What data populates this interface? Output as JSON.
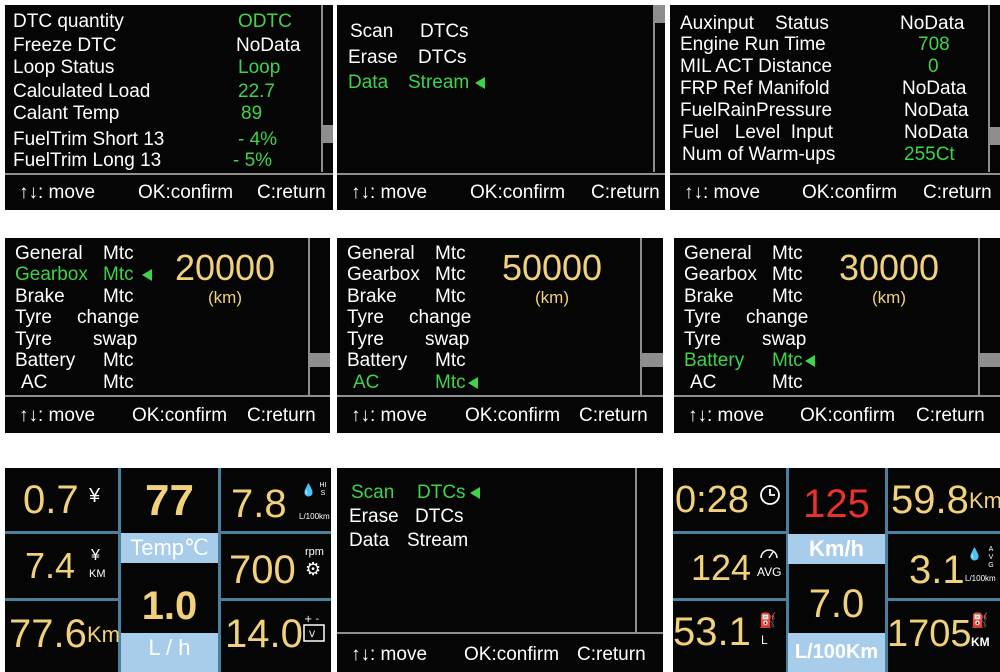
{
  "footer": {
    "move": "↑↓: move",
    "ok": "OK:confirm",
    "ret": "C:return"
  },
  "panel1": {
    "rows": [
      {
        "label": "DTC quantity",
        "value": "ODTC"
      },
      {
        "label": "Freeze DTC",
        "value": "NoData"
      },
      {
        "label": "Loop Status",
        "value": "Loop"
      },
      {
        "label": "Calculated Load",
        "value": "22.7"
      },
      {
        "label": "Calant Temp",
        "value": "89"
      },
      {
        "label": "FuelTrim Short 13",
        "value": "-  4%"
      },
      {
        "label": "FuelTrim Long 13",
        "value": "-  5%"
      }
    ]
  },
  "panel2": {
    "rows": [
      {
        "a": "Scan",
        "b": "DTCs"
      },
      {
        "a": "Erase",
        "b": "DTCs"
      },
      {
        "a": "Data",
        "b": "Stream"
      }
    ]
  },
  "panel3": {
    "rows": [
      {
        "label": "Auxinput    Status",
        "value": "NoData"
      },
      {
        "label": "Engine Run Time",
        "value": "708"
      },
      {
        "label": "MIL ACT Distance",
        "value": "0"
      },
      {
        "label": "FRP Ref Manifold",
        "value": "NoData"
      },
      {
        "label": "FuelRainPressure",
        "value": "NoData"
      },
      {
        "label": "Fuel   Level  Input",
        "value": "NoData"
      },
      {
        "label": "Num of Warm-ups",
        "value": "255Ct"
      }
    ]
  },
  "maint": {
    "items": [
      {
        "a": "General",
        "b": "Mtc"
      },
      {
        "a": "Gearbox",
        "b": "Mtc"
      },
      {
        "a": "Brake",
        "b": "Mtc"
      },
      {
        "a": "Tyre",
        "b": "change"
      },
      {
        "a": "Tyre",
        "b": "swap"
      },
      {
        "a": "Battery",
        "b": "Mtc"
      },
      {
        "a": "AC",
        "b": "Mtc"
      }
    ],
    "panel4_value": "20000",
    "panel5_value": "50000",
    "panel6_value": "30000",
    "unit": "(km)"
  },
  "panel8": {
    "rows": [
      {
        "a": "Scan",
        "b": "DTCs"
      },
      {
        "a": "Erase",
        "b": "DTCs"
      },
      {
        "a": "Data",
        "b": "Stream"
      }
    ]
  },
  "dash1": {
    "tl": "0.7",
    "tl_icon": "¥",
    "ml": "7.4",
    "ml_icon1": "¥",
    "ml_icon2": "KM",
    "bl": "77.6",
    "bl_unit": "Km",
    "center_top": "77",
    "center_label": "Temp℃",
    "center_bottom": "1.0",
    "center_bottom_label": "L / h",
    "tr": "7.8",
    "tr_icon_letters": "HIS",
    "tr_unit": "L/100km",
    "mr": "700",
    "mr_unit": "rpm",
    "br": "14.0"
  },
  "dash2": {
    "tl": "0:28",
    "ml": "124",
    "ml_icon": "AVG",
    "bl": "53.1",
    "bl_icon": "L",
    "center_top": "125",
    "center_label": "Km/h",
    "center_bottom": "7.0",
    "center_bottom_label": "L/100Km",
    "tr": "59.8",
    "tr_unit": "Km",
    "mr": "3.1",
    "mr_icon_letters": "AVG",
    "mr_unit": "L/100km",
    "br": "1705",
    "br_unit": "KM"
  },
  "colors": {
    "green": "#3fd34a",
    "yellow": "#f1d27a",
    "red": "#e8322a",
    "lightblue": "#a8cdea",
    "grey": "#8e8e8e"
  }
}
